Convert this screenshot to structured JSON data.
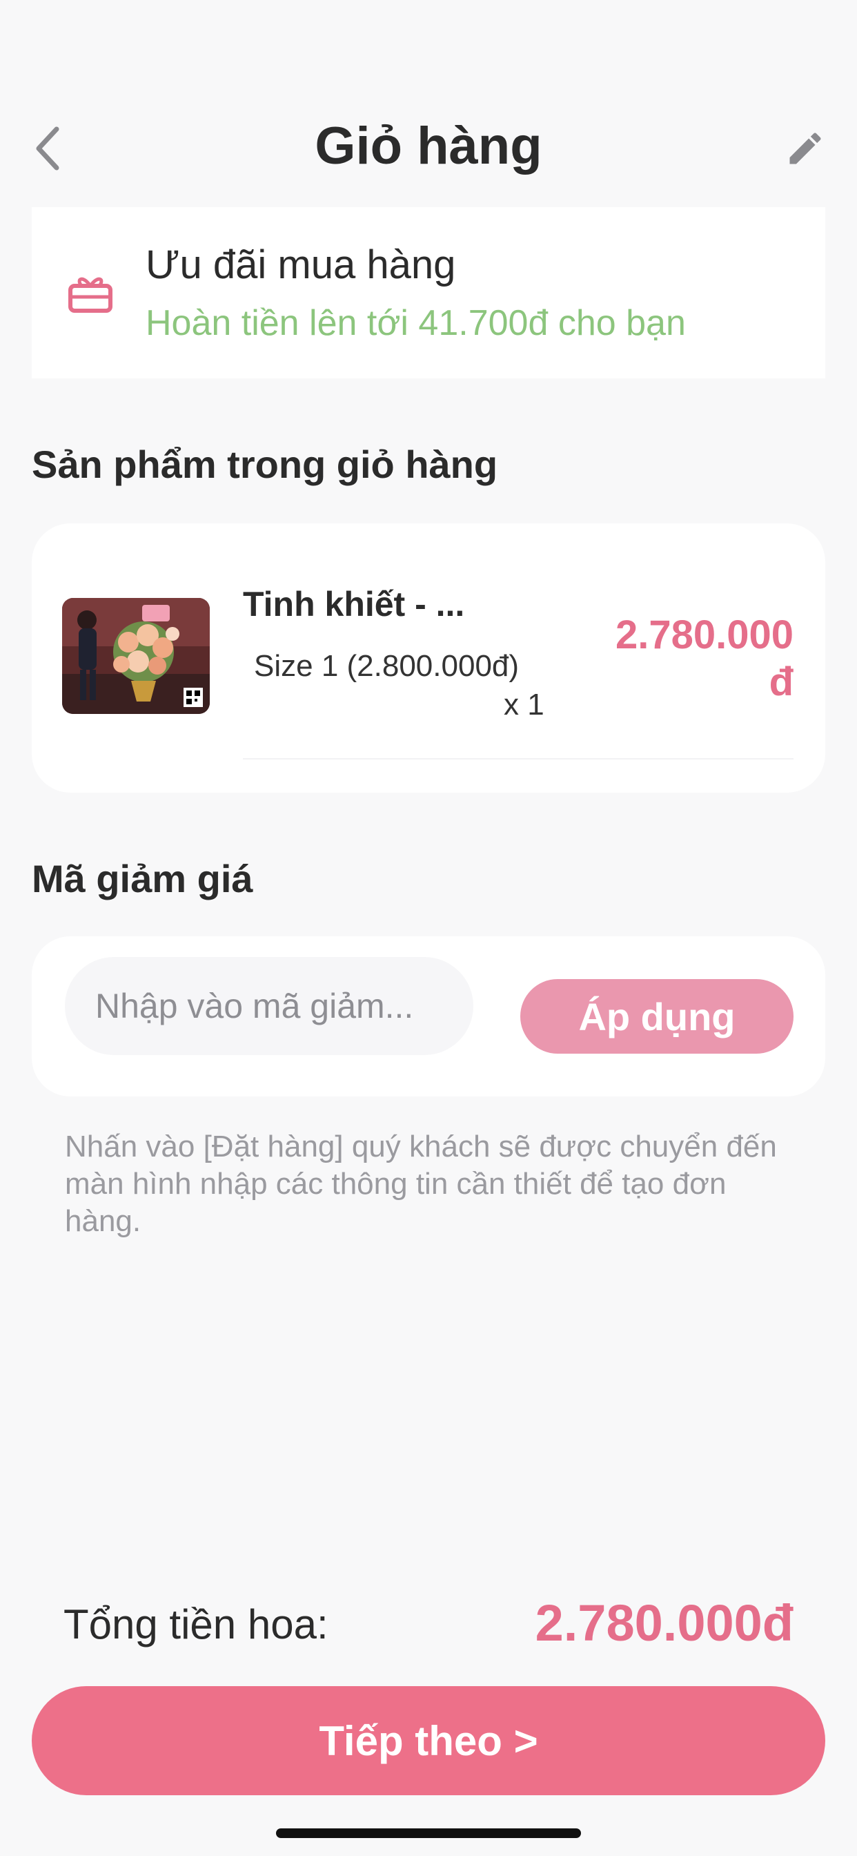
{
  "header": {
    "title": "Giỏ hàng",
    "back_icon": "chevron-left-icon",
    "edit_icon": "pencil-icon"
  },
  "promo": {
    "icon": "gift-icon",
    "title": "Ưu đãi mua hàng",
    "subtitle": "Hoàn tiền lên tới 41.700đ cho bạn"
  },
  "cart": {
    "section_title": "Sản phẩm trong giỏ hàng",
    "items": [
      {
        "name": "Tinh khiết - ...",
        "size": "Size 1 (2.800.000đ)",
        "quantity": "x 1",
        "price_line1": "2.780.000",
        "price_line2": "đ"
      }
    ]
  },
  "coupon": {
    "section_title": "Mã giảm giá",
    "placeholder": "Nhập vào mã giảm...",
    "apply_label": "Áp dụng"
  },
  "note": "Nhấn vào [Đặt hàng] quý khách sẽ được chuyển đến màn hình nhập các thông tin cần thiết để tạo đơn hàng.",
  "footer": {
    "total_label": "Tổng tiền hoa:",
    "total_value": "2.780.000đ",
    "next_label": "Tiếp theo >"
  },
  "colors": {
    "accent": "#ed7089",
    "price": "#e56e8a",
    "promo_green": "#8cc57d",
    "apply_button": "#ea97ae",
    "background": "#f8f8f9"
  }
}
